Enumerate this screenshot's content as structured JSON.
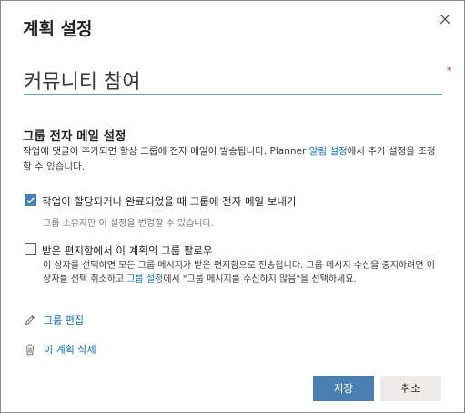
{
  "dialog": {
    "title": "계획 설정",
    "close_icon": "close-icon",
    "required_mark": "*"
  },
  "plan_name": {
    "value": "커뮤니티 참여"
  },
  "group_email": {
    "title": "그룹 전자 메일 설정",
    "desc_before": "작업에 댓글이 추가되면 항상 그룹에 전자 메일이 발송됩니다. Planner ",
    "desc_link": "알림 설정",
    "desc_after": "에서 추가 설정을 조정할 수 있습니다."
  },
  "option_assign": {
    "checked": true,
    "label": "작업이 할당되거나 완료되었을 때 그룹에 전자 메일 보내기",
    "sub": "그룹 소유자만 이 설정을 변경할 수 있습니다."
  },
  "option_follow": {
    "checked": false,
    "label": "받은 편지함에서 이 계획의 그룹 팔로우",
    "desc_before": "이 상자를 선택하면 모든 그룹 메시지가 받은 편지함으로 전송됩니다. 그룹 메시지 수신을 중지하려면 이 상자를 선택 취소하고 ",
    "desc_link": "그룹 설정",
    "desc_after": "에서 \"그룹 메시지를 수신하지 않음\"을 선택하세요."
  },
  "actions": {
    "edit_group": "그룹 편집",
    "edit_icon": "pencil-icon",
    "delete_plan": "이 계획 삭제",
    "delete_icon": "trash-icon"
  },
  "buttons": {
    "save": "저장",
    "cancel": "취소"
  },
  "colors": {
    "accent": "#4a7fb4",
    "link": "#106ebe",
    "required": "#c4314b"
  }
}
